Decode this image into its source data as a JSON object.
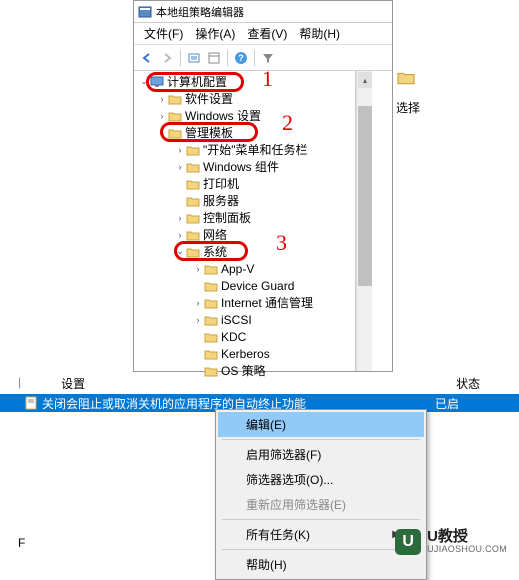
{
  "window": {
    "title": "本地组策略编辑器"
  },
  "menubar": {
    "file": "文件(F)",
    "action": "操作(A)",
    "view": "查看(V)",
    "help": "帮助(H)"
  },
  "tree": {
    "root": "计算机配置",
    "items": [
      {
        "label": "软件设置",
        "level": 1,
        "arrow": "right"
      },
      {
        "label": "Windows 设置",
        "level": 1,
        "arrow": "right"
      },
      {
        "label": "管理模板",
        "level": 1,
        "arrow": "down"
      },
      {
        "label": "\"开始\"菜单和任务栏",
        "level": 2,
        "arrow": "right"
      },
      {
        "label": "Windows 组件",
        "level": 2,
        "arrow": "right"
      },
      {
        "label": "打印机",
        "level": 2,
        "arrow": ""
      },
      {
        "label": "服务器",
        "level": 2,
        "arrow": ""
      },
      {
        "label": "控制面板",
        "level": 2,
        "arrow": "right"
      },
      {
        "label": "网络",
        "level": 2,
        "arrow": "right"
      },
      {
        "label": "系统",
        "level": 2,
        "arrow": "down"
      },
      {
        "label": "App-V",
        "level": 3,
        "arrow": "right"
      },
      {
        "label": "Device Guard",
        "level": 3,
        "arrow": ""
      },
      {
        "label": "Internet 通信管理",
        "level": 3,
        "arrow": "right"
      },
      {
        "label": "iSCSI",
        "level": 3,
        "arrow": "right"
      },
      {
        "label": "KDC",
        "level": 3,
        "arrow": ""
      },
      {
        "label": "Kerberos",
        "level": 3,
        "arrow": ""
      },
      {
        "label": "OS 策略",
        "level": 3,
        "arrow": ""
      }
    ]
  },
  "annotations": {
    "n1": "1",
    "n2": "2",
    "n3": "3"
  },
  "right_panel": {
    "label": "选择"
  },
  "list": {
    "col_setting": "设置",
    "col_status": "状态",
    "row_text": "关闭会阻止或取消关机的应用程序的自动终止功能",
    "row_status": "已启"
  },
  "context_menu": {
    "edit": "编辑(E)",
    "enable_filter": "启用筛选器(F)",
    "filter_options": "筛选器选项(O)...",
    "reapply_filter": "重新应用筛选器(E)",
    "all_tasks": "所有任务(K)",
    "help": "帮助(H)"
  },
  "watermark": {
    "brand": "U教授",
    "url": "UJIAOSHOU.COM",
    "logo": "U"
  },
  "footer": {
    "f": "F"
  }
}
